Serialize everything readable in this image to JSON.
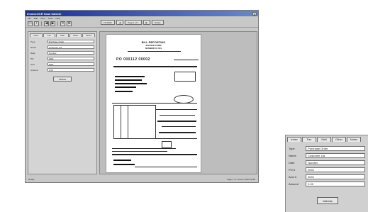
{
  "window": {
    "title": "InvoiceOCR Scan Indexer",
    "close_glyph": "x"
  },
  "menu": [
    "File",
    "Edit",
    "View",
    "Tools",
    "Help"
  ],
  "toolbar": {
    "buttons": [
      {
        "icon": "open-folder-icon",
        "glyph": "▭"
      },
      {
        "icon": "save-icon",
        "glyph": "▪"
      },
      {
        "icon": "back-arrow-icon",
        "glyph": "◀"
      },
      {
        "icon": "forward-arrow-icon",
        "glyph": "▶"
      },
      {
        "icon": "refresh-icon",
        "glyph": "↻"
      },
      {
        "icon": "zoom-icon",
        "glyph": "⊕"
      }
    ]
  },
  "doc_toolbar": {
    "fit_label": "Fit Width",
    "prev_label": "◀",
    "page_label": "Page 1 of 1",
    "next_label": "▶",
    "rotate_label": "Rotate"
  },
  "left_panel": {
    "tabs": [
      "Index",
      "Fax",
      "Mail",
      "Other",
      "Notes"
    ],
    "fields": [
      {
        "label": "Type",
        "value": "Purchase Order"
      },
      {
        "label": "Name",
        "value": "Customer Ltd."
      },
      {
        "label": "Date",
        "value": "Number"
      },
      {
        "label": "PO",
        "value": "0001"
      },
      {
        "label": "Acct",
        "value": "0001"
      },
      {
        "label": "Amount",
        "value": "0.00"
      }
    ],
    "button_label": "Validate"
  },
  "document": {
    "heading_line1": "BILL REPORTING",
    "heading_line2": "INVOICE FORM",
    "heading_line3": "NUMBER 01 001",
    "invoice_number": "PO 000112 00002"
  },
  "status": {
    "left": "Ready",
    "right": "Page 1 of 1   Zoom 100%   NUM"
  },
  "inset": {
    "tabs": [
      "Index",
      "Fax",
      "Mail",
      "Other",
      "Notes"
    ],
    "fields": [
      {
        "label": "Type",
        "value": "Purchase Order"
      },
      {
        "label": "Name",
        "value": "Customer Ltd."
      },
      {
        "label": "Date",
        "value": "Number"
      },
      {
        "label": "PO #",
        "value": "0001"
      },
      {
        "label": "Acct #",
        "value": "0001"
      },
      {
        "label": "Amount",
        "value": "0.00"
      }
    ],
    "button_label": "Validate"
  }
}
